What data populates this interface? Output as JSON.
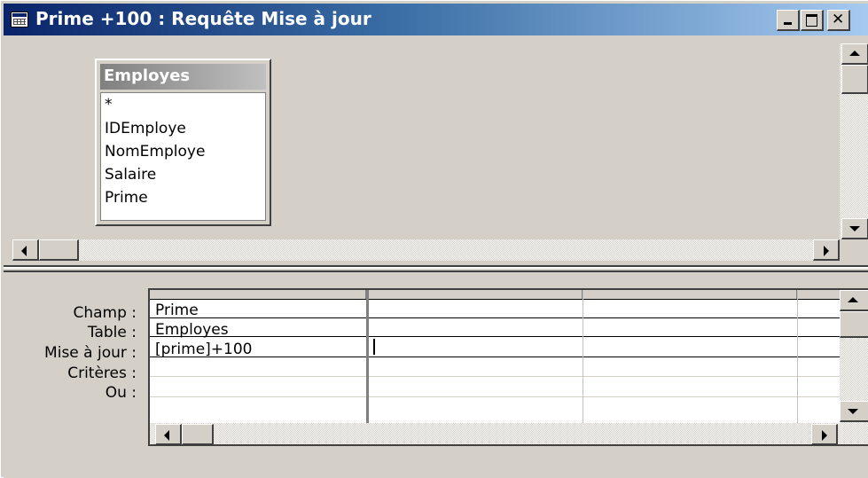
{
  "window": {
    "title": "Prime +100 : Requête Mise à jour"
  },
  "field_list": {
    "table_name": "Employes",
    "fields": [
      "*",
      "IDEmploye",
      "NomEmploye",
      "Salaire",
      "Prime"
    ]
  },
  "grid": {
    "row_labels": [
      "Champ :",
      "Table :",
      "Mise à jour :",
      "Critères :",
      "Ou :"
    ],
    "columns": [
      {
        "field": "Prime",
        "table": "Employes",
        "update_to": "[prime]+100",
        "criteria": "",
        "or": ""
      },
      {
        "field": "",
        "table": "",
        "update_to": "",
        "criteria": "",
        "or": ""
      },
      {
        "field": "",
        "table": "",
        "update_to": "",
        "criteria": "",
        "or": ""
      },
      {
        "field": "",
        "table": "",
        "update_to": "",
        "criteria": "",
        "or": ""
      }
    ]
  },
  "icons": {
    "app": "query-grid-icon",
    "minimize": "minimize-icon",
    "maximize": "maximize-icon",
    "close": "close-icon"
  },
  "colors": {
    "titlebar_start": "#0a246a",
    "titlebar_end": "#a6caf0",
    "face": "#d4d0c8"
  }
}
